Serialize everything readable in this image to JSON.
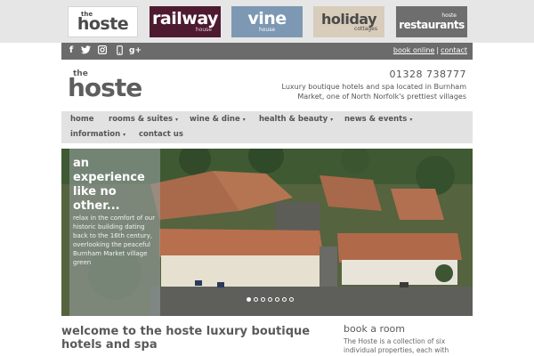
{
  "brands": {
    "hoste": {
      "pre": "the",
      "main": "hoste"
    },
    "railway": {
      "main": "railway",
      "small": "house"
    },
    "vine": {
      "main": "vine",
      "small": "house"
    },
    "holiday": {
      "main": "holiday",
      "small": "cottages"
    },
    "restaurants": {
      "pre": "hoste",
      "main": "restaurants"
    }
  },
  "social": {
    "facebook": "f",
    "twitter": "🐦",
    "instagram": "📷",
    "mobile": "▯",
    "googleplus": "g+"
  },
  "toplinks": {
    "book_online": "book online",
    "separator": "|",
    "contact": "contact"
  },
  "header": {
    "logo_the": "the",
    "logo_name": "hoste",
    "phone": "01328 738777",
    "tagline": "Luxury boutique hotels and spa located in Burnham Market, one of North Norfolk's prettiest villages"
  },
  "nav": {
    "items": [
      {
        "label": "home",
        "caret": ""
      },
      {
        "label": "rooms & suites",
        "caret": "▾"
      },
      {
        "label": "wine & dine",
        "caret": "▾"
      },
      {
        "label": "health & beauty",
        "caret": "▾"
      },
      {
        "label": "news & events",
        "caret": "▾"
      },
      {
        "label": "information",
        "caret": "▾"
      },
      {
        "label": "contact us",
        "caret": ""
      }
    ]
  },
  "hero": {
    "title": "an experience like no other...",
    "text": "relax in the comfort of our historic building dating back to the 16th century, overlooking the peaceful Burnham Market village green",
    "slides_total": 7,
    "active_slide": 1
  },
  "welcome": {
    "title": "welcome to the hoste luxury boutique hotels and spa"
  },
  "book": {
    "title": "book a room",
    "text": "The Hoste is a collection of six individual properties, each with superb, individually"
  },
  "colors": {
    "railway": "#4d1a2f",
    "vine": "#7d98b3",
    "holiday": "#d8ccbb",
    "restaurants": "#6e6e6e",
    "socialbar": "#6b6b6b",
    "nav": "#e2e2e2"
  }
}
